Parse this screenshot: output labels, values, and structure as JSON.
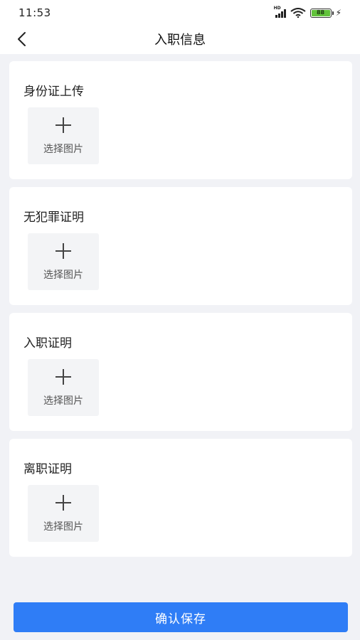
{
  "status_bar": {
    "time": "11:53",
    "signal_badge": "HD",
    "battery_level": "88",
    "icons": [
      "signal-icon",
      "wifi-icon",
      "battery-icon",
      "charging-icon"
    ]
  },
  "nav": {
    "title": "入职信息",
    "back_icon": "chevron-left-icon"
  },
  "sections": [
    {
      "title": "身份证上传",
      "upload_label": "选择图片"
    },
    {
      "title": "无犯罪证明",
      "upload_label": "选择图片"
    },
    {
      "title": "入职证明",
      "upload_label": "选择图片"
    },
    {
      "title": "离职证明",
      "upload_label": "选择图片"
    }
  ],
  "confirm_button": {
    "label": "确认保存"
  },
  "colors": {
    "primary": "#2f7df6",
    "page_background": "#f1f2f6",
    "card_background": "#ffffff",
    "upload_background": "#f3f4f6",
    "battery": "#61c23b"
  }
}
